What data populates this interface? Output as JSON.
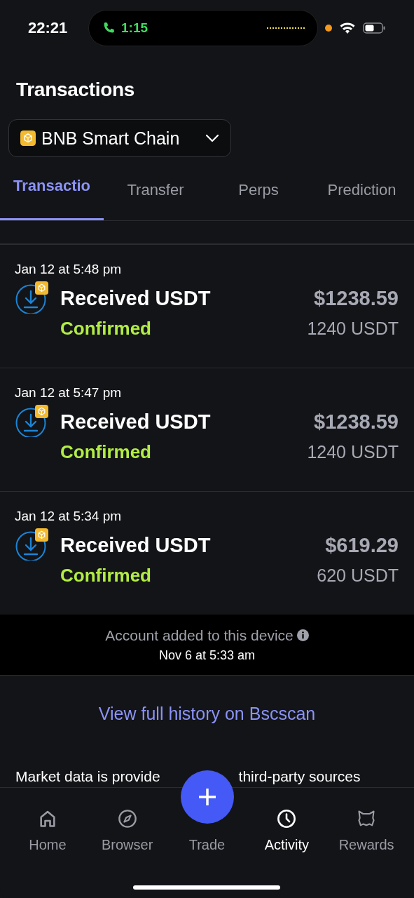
{
  "status_bar": {
    "time": "22:21",
    "call_timer": "1:15"
  },
  "header": {
    "title": "Transactions"
  },
  "network_selector": {
    "label": "BNB Smart Chain"
  },
  "tabs": [
    {
      "label": "Transactio",
      "selected": true
    },
    {
      "label": "Transfer",
      "selected": false
    },
    {
      "label": "Perps",
      "selected": false
    },
    {
      "label": "Prediction",
      "selected": false
    }
  ],
  "transactions": [
    {
      "date": "Jan 12 at 5:48 pm",
      "title": "Received USDT",
      "status": "Confirmed",
      "amount_usd": "$1238.59",
      "amount_token": "1240 USDT"
    },
    {
      "date": "Jan 12 at 5:47 pm",
      "title": "Received USDT",
      "status": "Confirmed",
      "amount_usd": "$1238.59",
      "amount_token": "1240 USDT"
    },
    {
      "date": "Jan 12 at 5:34 pm",
      "title": "Received USDT",
      "status": "Confirmed",
      "amount_usd": "$619.29",
      "amount_token": "620 USDT"
    }
  ],
  "account_notice": {
    "label": "Account added to this device",
    "date": "Nov 6 at 5:33 am"
  },
  "history_link": "View full history on Bscscan",
  "disclaimer": {
    "before": "Market data is provide",
    "after": "third-party sources"
  },
  "bottom_nav": [
    {
      "label": "Home",
      "selected": false,
      "kind": "tab"
    },
    {
      "label": "Browser",
      "selected": false,
      "kind": "tab"
    },
    {
      "label": "Trade",
      "selected": false,
      "kind": "fab"
    },
    {
      "label": "Activity",
      "selected": true,
      "kind": "tab"
    },
    {
      "label": "Rewards",
      "selected": false,
      "kind": "tab"
    }
  ]
}
